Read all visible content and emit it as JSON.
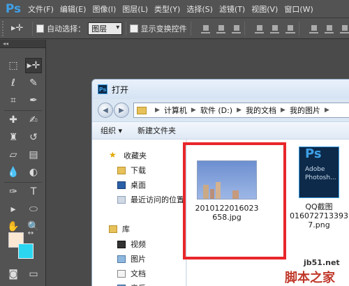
{
  "app": {
    "logo": "Ps"
  },
  "menu": [
    "文件(F)",
    "编辑(E)",
    "图像(I)",
    "图层(L)",
    "类型(Y)",
    "选择(S)",
    "滤镜(T)",
    "视图(V)",
    "窗口(W)"
  ],
  "options": {
    "auto_select_label": "自动选择：",
    "layer_select_value": "图层",
    "show_transform_label": "显示变换控件"
  },
  "colors": {
    "foreground": "#fbe8d3",
    "background": "#2bd6f0",
    "highlight": "#e8262b"
  },
  "dialog": {
    "title": "打开",
    "breadcrumbs": [
      "计算机",
      "软件 (D:)",
      "我的文档",
      "我的图片"
    ],
    "cmd_organize": "组织 ▾",
    "cmd_new_folder": "新建文件夹",
    "nav": {
      "favorites": "收藏夹",
      "downloads": "下载",
      "desktop": "桌面",
      "recent": "最近访问的位置",
      "library": "库",
      "videos": "视频",
      "pictures": "图片",
      "documents": "文档",
      "music": "音乐"
    },
    "files": [
      {
        "name_line1": "2010122016023",
        "name_line2": "658.jpg"
      },
      {
        "name_line1": "QQ截图",
        "name_line2": "016072713393",
        "name_line3": "7.png",
        "thumb_text1": "Adobe",
        "thumb_text2": "Photosh..."
      }
    ]
  },
  "watermark": {
    "site": "jb51.net",
    "name": "脚本之家"
  }
}
